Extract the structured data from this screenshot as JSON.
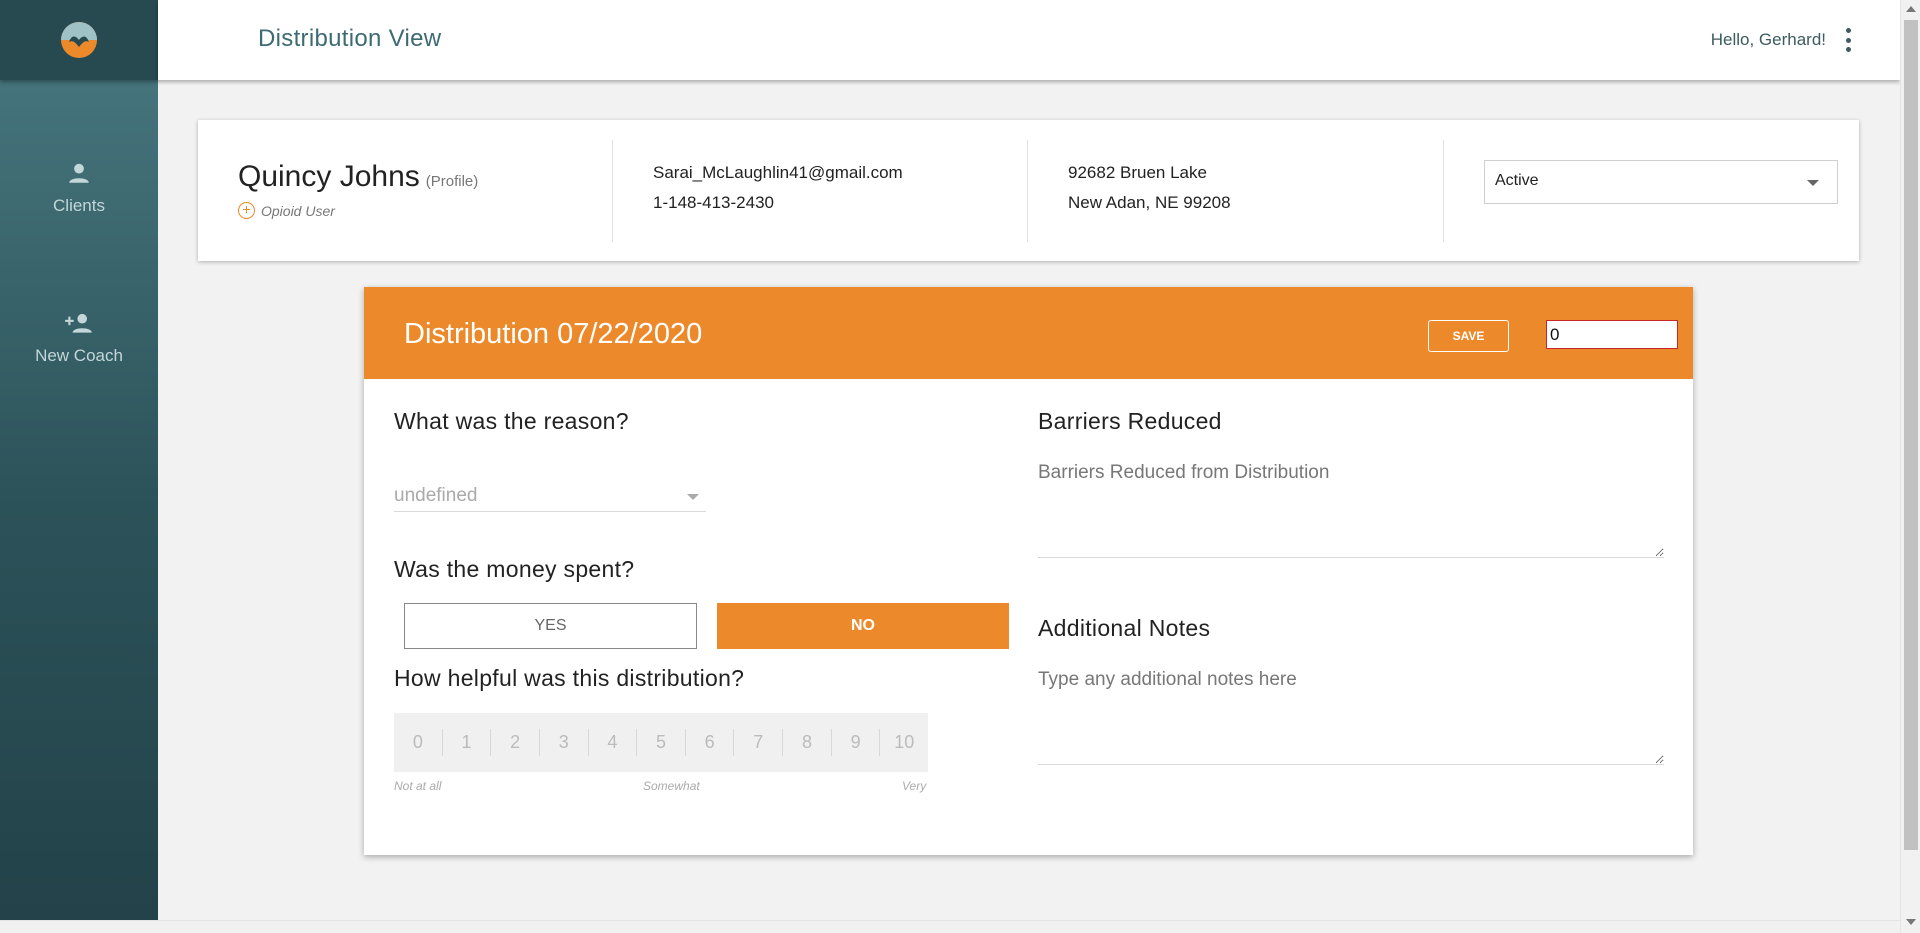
{
  "sidebar": {
    "logo": "brand-logo",
    "items": [
      {
        "label": "Clients",
        "icon": "person-icon"
      },
      {
        "label": "New Coach",
        "icon": "person-add-icon"
      }
    ]
  },
  "header": {
    "title": "Distribution View",
    "greeting": "Hello, Gerhard!"
  },
  "client": {
    "name": "Quincy Johns",
    "profile_link": "(Profile)",
    "tag": "Opioid User",
    "email": "Sarai_McLaughlin41@gmail.com",
    "phone": "1-148-413-2430",
    "address_line1": "92682 Bruen Lake",
    "address_line2": "New Adan, NE 99208",
    "status": "Active"
  },
  "distribution": {
    "title": "Distribution 07/22/2020",
    "save_label": "SAVE",
    "amount": "0",
    "reason_question": "What was the reason?",
    "reason_value": "undefined",
    "money_question": "Was the money spent?",
    "yes_label": "YES",
    "no_label": "NO",
    "selected_spent": "NO",
    "helpful_question": "How helpful was this distribution?",
    "rating_options": [
      "0",
      "1",
      "2",
      "3",
      "4",
      "5",
      "6",
      "7",
      "8",
      "9",
      "10"
    ],
    "scale_low": "Not at all",
    "scale_mid": "Somewhat",
    "scale_high": "Very",
    "barriers_title": "Barriers Reduced",
    "barriers_placeholder": "Barriers Reduced from Distribution",
    "notes_title": "Additional Notes",
    "notes_placeholder": "Type any additional notes here"
  },
  "colors": {
    "accent": "#ec8a2b",
    "sidebar": "#2c5259",
    "title_text": "#3d6b73"
  }
}
